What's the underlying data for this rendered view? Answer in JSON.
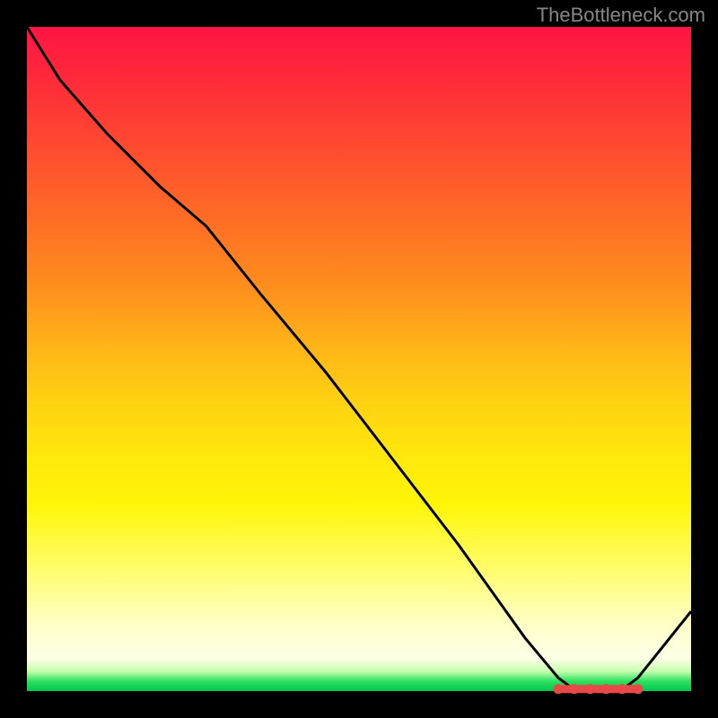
{
  "watermark": "TheBottleneck.com",
  "chart_data": {
    "type": "line",
    "title": "",
    "xlabel": "",
    "ylabel": "",
    "xlim": [
      0,
      100
    ],
    "ylim": [
      0,
      100
    ],
    "series": [
      {
        "name": "curve",
        "x": [
          0,
          5,
          12,
          20,
          27,
          35,
          45,
          55,
          65,
          75,
          80,
          82,
          85,
          88,
          90,
          92,
          100
        ],
        "values": [
          100,
          92,
          84,
          76,
          70,
          60,
          48,
          35,
          22,
          8,
          2,
          0.5,
          0.3,
          0.3,
          0.5,
          2,
          12
        ]
      }
    ],
    "optimal_band": {
      "name": "optimal-range-marker",
      "x_start": 80,
      "x_end": 92,
      "y": 0.3,
      "color": "#e84848"
    },
    "colors": {
      "line": "#000000",
      "marker": "#e84848",
      "grid": null
    }
  }
}
